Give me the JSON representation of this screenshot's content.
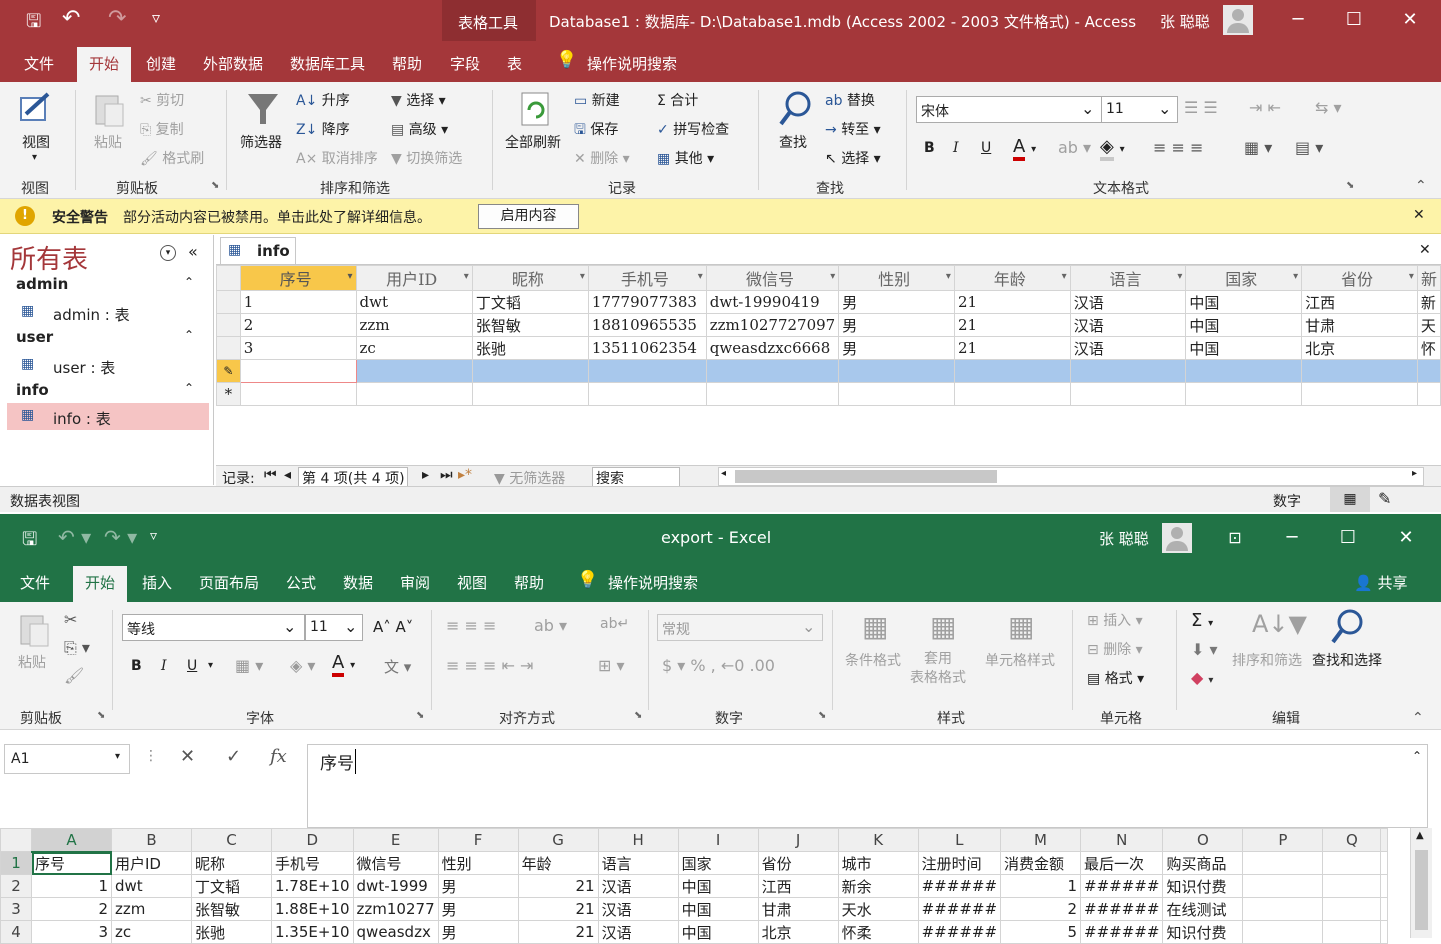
{
  "access": {
    "qat": {
      "save": "🖫",
      "undo": "↶",
      "redo": "↷",
      "more": "▿"
    },
    "context_tool": "表格工具",
    "title": "Database1 : 数据库- D:\\Database1.mdb (Access 2002 - 2003 文件格式)  -  Access",
    "user": "张 聪聪",
    "tabs": [
      "文件",
      "开始",
      "创建",
      "外部数据",
      "数据库工具",
      "帮助",
      "字段",
      "表"
    ],
    "tell_me": "操作说明搜索",
    "ribbon": {
      "view": {
        "label": "视图",
        "group": "视图"
      },
      "clipboard": {
        "paste": "粘贴",
        "cut": "剪切",
        "copy": "复制",
        "format_painter": "格式刷",
        "group": "剪贴板"
      },
      "sort": {
        "filter": "筛选器",
        "asc": "升序",
        "desc": "降序",
        "clear_sort": "取消排序",
        "selection": "选择",
        "advanced": "高级",
        "toggle_filter": "切换筛选",
        "group": "排序和筛选"
      },
      "records": {
        "refresh_all": "全部刷新",
        "new": "新建",
        "save": "保存",
        "delete": "删除",
        "totals": "合计",
        "spelling": "拼写检查",
        "more": "其他",
        "group": "记录"
      },
      "find": {
        "find": "查找",
        "replace": "替换",
        "goto": "转至",
        "select": "选择",
        "group": "查找"
      },
      "text_format": {
        "font": "宋体",
        "size": "11",
        "bold": "B",
        "italic": "I",
        "underline": "U",
        "group": "文本格式"
      }
    },
    "warning": {
      "title": "安全警告",
      "message": "部分活动内容已被禁用。单击此处了解详细信息。",
      "button": "启用内容"
    },
    "nav": {
      "title": "所有表",
      "groups": [
        {
          "name": "admin",
          "item": "admin : 表"
        },
        {
          "name": "user",
          "item": "user : 表"
        },
        {
          "name": "info",
          "item": "info : 表"
        }
      ]
    },
    "doc_tab": "info",
    "columns": [
      "序号",
      "用户ID",
      "昵称",
      "手机号",
      "微信号",
      "性别",
      "年龄",
      "语言",
      "国家",
      "省份",
      "新"
    ],
    "rows": [
      [
        "1",
        "dwt",
        "丁文韬",
        "17779077383",
        "dwt-19990419",
        "男",
        "21",
        "汉语",
        "中国",
        "江西",
        "新"
      ],
      [
        "2",
        "zzm",
        "张智敏",
        "18810965535",
        "zzm1027727097",
        "男",
        "21",
        "汉语",
        "中国",
        "甘肃",
        "天"
      ],
      [
        "3",
        "zc",
        "张驰",
        "13511062354",
        "qweasdzxc6668",
        "男",
        "21",
        "汉语",
        "中国",
        "北京",
        "怀"
      ]
    ],
    "record_nav": {
      "label": "记录:",
      "position": "第 4 项(共 4 项)",
      "no_filter": "无筛选器",
      "search": "搜索"
    },
    "status": {
      "left": "数据表视图",
      "numlock": "数字"
    }
  },
  "excel": {
    "title": "export  -  Excel",
    "user": "张 聪聪",
    "tabs": [
      "文件",
      "开始",
      "插入",
      "页面布局",
      "公式",
      "数据",
      "审阅",
      "视图",
      "帮助"
    ],
    "tell_me": "操作说明搜索",
    "share": "共享",
    "ribbon": {
      "clipboard": {
        "paste": "粘贴",
        "group": "剪贴板"
      },
      "font": {
        "name": "等线",
        "size": "11",
        "bold": "B",
        "italic": "I",
        "underline": "U",
        "group": "字体"
      },
      "align": {
        "group": "对齐方式"
      },
      "number": {
        "format": "常规",
        "group": "数字"
      },
      "styles": {
        "cond": "条件格式",
        "table": "套用\n表格格式",
        "cell": "单元格样式",
        "group": "样式"
      },
      "cells": {
        "insert": "插入",
        "delete": "删除",
        "format": "格式",
        "group": "单元格"
      },
      "edit": {
        "sort": "排序和筛选",
        "find": "查找和选择",
        "group": "编辑"
      }
    },
    "name_box": "A1",
    "formula": "序号",
    "col_headers": [
      "A",
      "B",
      "C",
      "D",
      "E",
      "F",
      "G",
      "H",
      "I",
      "J",
      "K",
      "L",
      "M",
      "N",
      "O",
      "P",
      "Q"
    ],
    "rows": [
      {
        "num": "1",
        "cells": [
          "序号",
          "用户ID",
          "昵称",
          "手机号",
          "微信号",
          "性别",
          "年龄",
          "语言",
          "国家",
          "省份",
          "城市",
          "注册时间",
          "消费金额",
          "最后一次",
          "购买商品",
          "",
          ""
        ]
      },
      {
        "num": "2",
        "cells": [
          "1",
          "dwt",
          "丁文韬",
          "1.78E+10",
          "dwt-1999",
          "男",
          "21",
          "汉语",
          "中国",
          "江西",
          "新余",
          "######",
          "1",
          "######",
          "知识付费",
          "",
          ""
        ]
      },
      {
        "num": "3",
        "cells": [
          "2",
          "zzm",
          "张智敏",
          "1.88E+10",
          "zzm10277",
          "男",
          "21",
          "汉语",
          "中国",
          "甘肃",
          "天水",
          "######",
          "2",
          "######",
          "在线测试",
          "",
          ""
        ]
      },
      {
        "num": "4",
        "cells": [
          "3",
          "zc",
          "张驰",
          "1.35E+10",
          "qweasdzx",
          "男",
          "21",
          "汉语",
          "中国",
          "北京",
          "怀柔",
          "######",
          "5",
          "######",
          "知识付费",
          "",
          ""
        ]
      }
    ]
  }
}
